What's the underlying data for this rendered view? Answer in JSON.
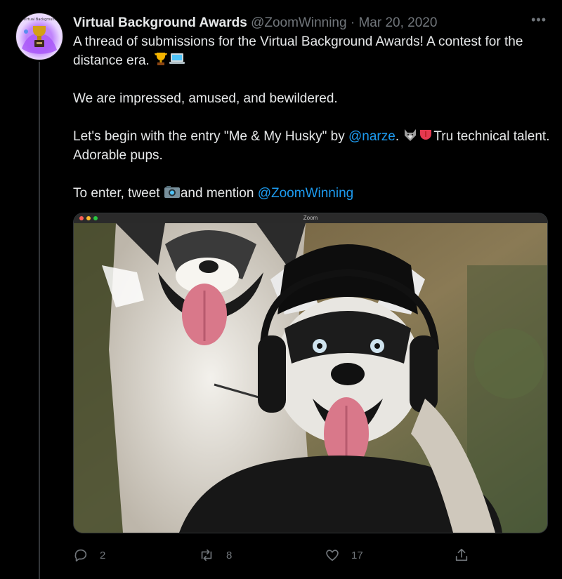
{
  "tweet": {
    "display_name": "Virtual Background Awards",
    "handle": "@ZoomWinning",
    "separator": "·",
    "date": "Mar 20, 2020",
    "more_label": "•••",
    "avatar_mini_text": "Virtual Background",
    "line1": "A thread of submissions for the Virtual Background Awards! A contest for the distance era.",
    "line2": "We are impressed, amused, and bewildered.",
    "line3_a": "Let's begin with the entry \"Me & My Husky\" by",
    "line3_mention": "@narze",
    "line3_b": ".",
    "line3_c": "Tru technical talent. Adorable pups.",
    "line4_a": "To enter, tweet",
    "line4_b": "and mention",
    "line4_mention": "@ZoomWinning",
    "media": {
      "window_title": "Zoom",
      "alt_icon": "husky-photo"
    },
    "actions": {
      "reply_count": "2",
      "retweet_count": "8",
      "like_count": "17"
    }
  },
  "colors": {
    "background": "#000000",
    "text": "#e7e9ea",
    "muted": "#71767b",
    "link": "#1d9bf0",
    "thread_line": "#333639"
  },
  "icons": [
    "reply-icon",
    "retweet-icon",
    "like-icon",
    "share-icon",
    "trophy-icon",
    "laptop-icon",
    "wolf-icon",
    "tongue-icon",
    "camera-icon",
    "more-icon"
  ]
}
